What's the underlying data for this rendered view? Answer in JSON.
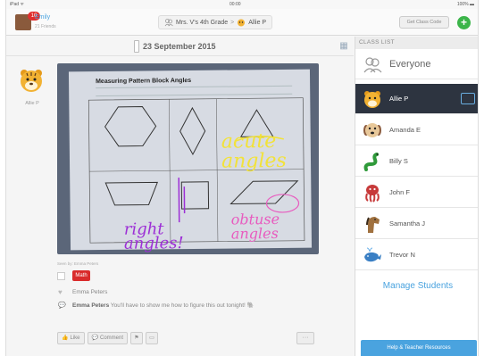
{
  "status": {
    "carrier": "iPad ᯤ",
    "time": "00:00",
    "battery": "100% ▬"
  },
  "header": {
    "notification_count": "10",
    "user_name": "Emily",
    "user_sub": "21 Friends",
    "breadcrumb_class": "Mrs. V's 4th Grade",
    "breadcrumb_sep": ">",
    "breadcrumb_student": "Allie P",
    "class_code_label": "Get Class Code",
    "add_label": "+"
  },
  "feed": {
    "date": "23 September 2015",
    "post": {
      "author": "Allie P",
      "worksheet_title": "Measuring Pattern Block Angles",
      "annotation_acute_1": "acute",
      "annotation_acute_2": "angles",
      "annotation_right_1": "right",
      "annotation_right_2": "angles!",
      "annotation_obtuse_1": "obtuse",
      "annotation_obtuse_2": "angles",
      "meta": "Seen by: Emma Peters",
      "tag": "Math",
      "liked_by": "Emma Peters",
      "comment_author": "Emma Peters",
      "comment_body": " You'll have to show me how to figure this out tonight! 🐘"
    },
    "actions": {
      "like": "Like",
      "comment": "Comment",
      "more": "···"
    }
  },
  "sidebar": {
    "heading": "CLASS LIST",
    "everyone": "Everyone",
    "students": [
      {
        "name": "Allie P",
        "icon": "tiger-icon",
        "selected": true
      },
      {
        "name": "Amanda E",
        "icon": "dog-icon"
      },
      {
        "name": "Billy S",
        "icon": "snake-icon"
      },
      {
        "name": "John F",
        "icon": "octopus-icon"
      },
      {
        "name": "Samantha J",
        "icon": "horse-icon"
      },
      {
        "name": "Trevor N",
        "icon": "whale-icon"
      }
    ],
    "manage_label": "Manage Students",
    "help_label": "Help & Teacher Resources"
  },
  "colors": {
    "accent": "#4aa3df",
    "add_green": "#3cb54a",
    "tag_red": "#d92b2b",
    "selected_bg": "#2d3440"
  }
}
